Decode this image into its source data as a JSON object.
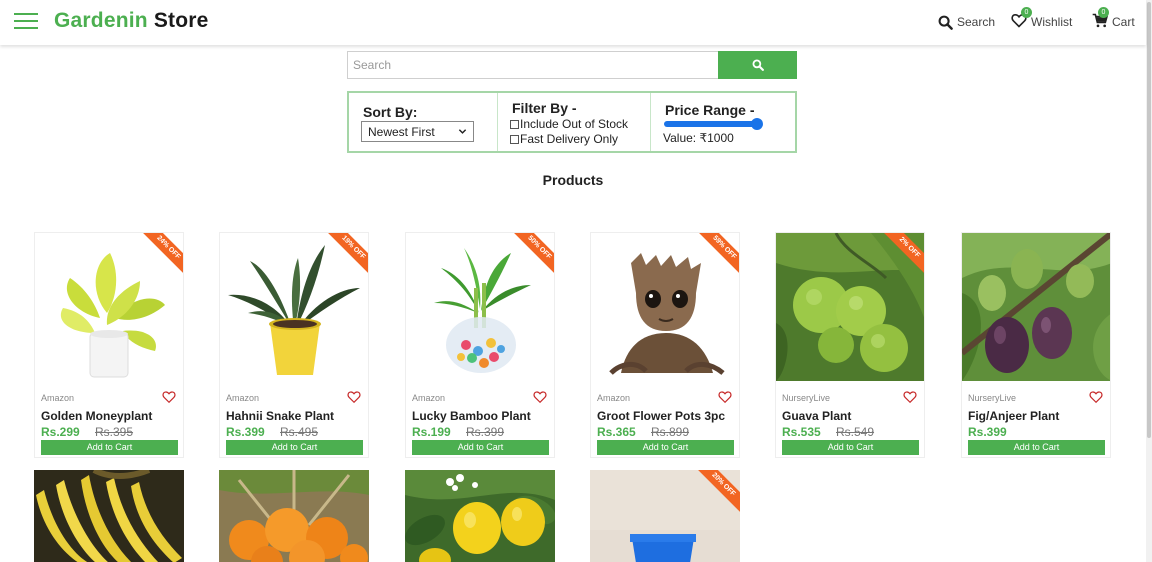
{
  "header": {
    "brand_green": "Gardenin",
    "brand_dark": "Store",
    "nav_search": "Search",
    "nav_wishlist": "Wishlist",
    "nav_cart": "Cart",
    "wishlist_count": "0",
    "cart_count": "0",
    "accent_color": "#4caf50"
  },
  "search": {
    "placeholder": "Search"
  },
  "filters": {
    "sort_label": "Sort By:",
    "sort_selected": "Newest First",
    "filter_label": "Filter By -",
    "option_out_of_stock": "Include Out of Stock",
    "option_fast_delivery": "Fast Delivery Only",
    "price_label": "Price Range -",
    "price_value": "Value: ₹1000",
    "slider_level": 1.0
  },
  "section_title": "Products",
  "products": [
    {
      "name": "Golden Moneyplant",
      "seller": "Amazon",
      "price": "Rs.299",
      "mrp": "Rs.395",
      "discount": "24% OFF",
      "button": "Add to Cart"
    },
    {
      "name": "Hahnii Snake Plant",
      "seller": "Amazon",
      "price": "Rs.399",
      "mrp": "Rs.495",
      "discount": "19% OFF",
      "button": "Add to Cart"
    },
    {
      "name": "Lucky Bamboo Plant",
      "seller": "Amazon",
      "price": "Rs.199",
      "mrp": "Rs.399",
      "discount": "50% OFF",
      "button": "Add to Cart"
    },
    {
      "name": "Groot Flower Pots 3pc",
      "seller": "Amazon",
      "price": "Rs.365",
      "mrp": "Rs.899",
      "discount": "59% OFF",
      "button": "Add to Cart"
    },
    {
      "name": "Guava Plant",
      "seller": "NurseryLive",
      "price": "Rs.535",
      "mrp": "Rs.549",
      "discount": "2% OFF",
      "button": "Add to Cart"
    },
    {
      "name": "Fig/Anjeer Plant",
      "seller": "NurseryLive",
      "price": "Rs.399",
      "mrp": "",
      "discount": "",
      "button": "Add to Cart"
    }
  ],
  "partial_products": [
    {
      "discount": ""
    },
    {
      "discount": ""
    },
    {
      "discount": ""
    },
    {
      "discount": "20% OFF"
    }
  ]
}
